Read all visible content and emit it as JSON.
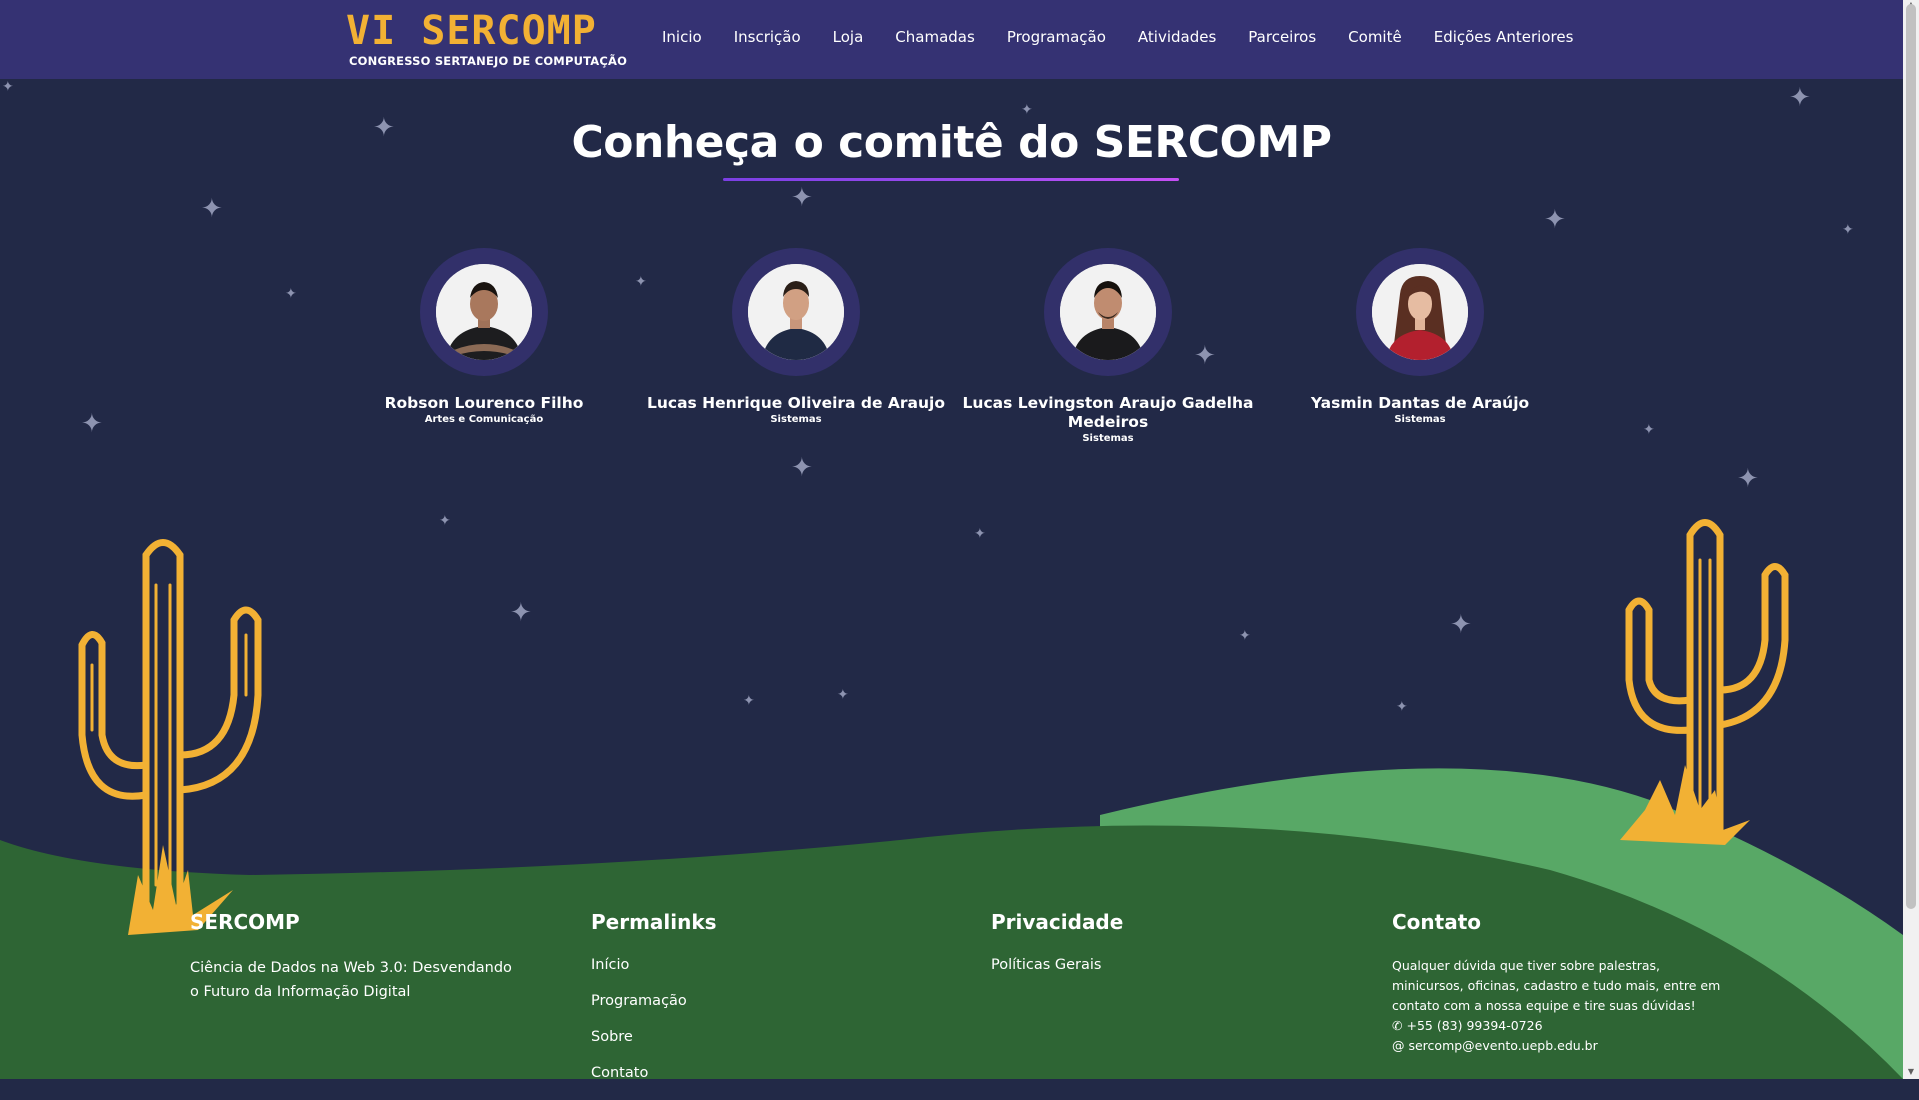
{
  "header": {
    "logo_main": "VI SERCOMP",
    "logo_sub": "CONGRESSO SERTANEJO DE COMPUTAÇÃO",
    "nav": [
      "Inicio",
      "Inscrição",
      "Loja",
      "Chamadas",
      "Programação",
      "Atividades",
      "Parceiros",
      "Comitê",
      "Edições Anteriores"
    ]
  },
  "main": {
    "title": "Conheça o comitê do SERCOMP",
    "members": [
      {
        "name": "Robson Lourenco Filho",
        "role": "Artes e Comunicação"
      },
      {
        "name": "Lucas Henrique Oliveira de Araujo",
        "role": "Sistemas"
      },
      {
        "name": "Lucas Levingston Araujo Gadelha Medeiros",
        "role": "Sistemas"
      },
      {
        "name": "Yasmin Dantas de Araújo",
        "role": "Sistemas"
      }
    ]
  },
  "footer": {
    "sercomp": {
      "heading": "SERCOMP",
      "text": "Ciência de Dados na Web 3.0: Desvendando o Futuro da Informação Digital"
    },
    "permalinks": {
      "heading": "Permalinks",
      "links": [
        "Início",
        "Programação",
        "Sobre",
        "Contato"
      ]
    },
    "privacy": {
      "heading": "Privacidade",
      "links": [
        "Políticas Gerais"
      ]
    },
    "contact": {
      "heading": "Contato",
      "text": "Qualquer dúvida que tiver sobre palestras, minicursos, oficinas, cadastro e tudo mais, entre em contato com a nossa equipe e tire suas dúvidas!",
      "phone": "+55 (83) 99394-0726",
      "email": "sercomp@evento.uepb.edu.br"
    }
  },
  "colors": {
    "header_bg": "#353273",
    "page_bg": "#222947",
    "accent_yellow": "#f2b134",
    "hill_dark": "#2e6534",
    "hill_light": "#58a866"
  },
  "icons": [
    "phone-icon",
    "at-icon",
    "star-icon",
    "cactus-icon"
  ]
}
